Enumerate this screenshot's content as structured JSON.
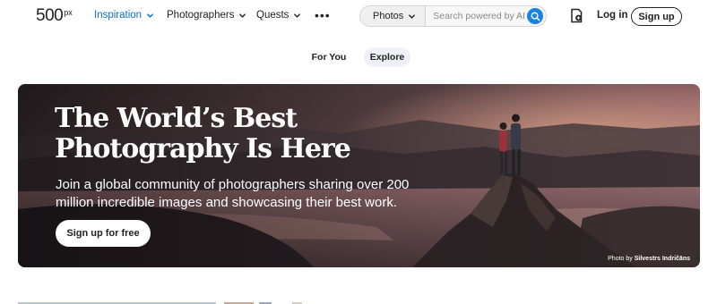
{
  "brand": {
    "logo_main": "500",
    "logo_sup": "px"
  },
  "nav": {
    "items": [
      {
        "label": "Inspiration",
        "active": true
      },
      {
        "label": "Photographers",
        "active": false
      },
      {
        "label": "Quests",
        "active": false
      }
    ],
    "more_icon": "more-dots-icon"
  },
  "search": {
    "category": "Photos",
    "placeholder": "Search powered by AI",
    "icon": "search-icon"
  },
  "account": {
    "upload_icon": "upload-icon",
    "login_label": "Log in",
    "signup_label": "Sign up"
  },
  "tabs": [
    {
      "label": "For You",
      "selected": false
    },
    {
      "label": "Explore",
      "selected": true
    }
  ],
  "hero": {
    "title": "The World’s Best Photography Is Here",
    "subtitle": "Join a global community of photographers sharing over 200 million incredible images and showcasing their best work.",
    "cta_label": "Sign up for free",
    "credit_prefix": "Photo by",
    "credit_name": "Silvestrs Indričāns"
  },
  "colors": {
    "accent": "#0870d1",
    "search_button": "#1b82e3",
    "tab_selected_bg": "#eef2f7"
  }
}
